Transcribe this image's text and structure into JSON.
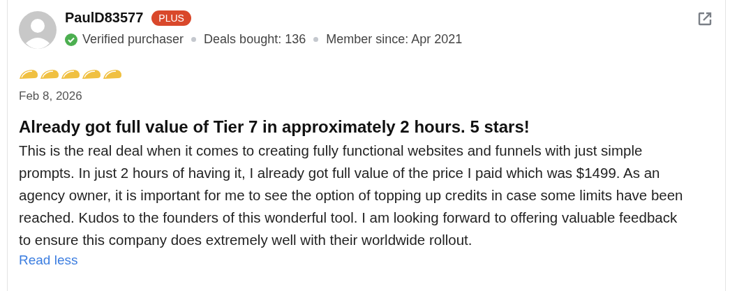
{
  "review": {
    "username": "PaulD83577",
    "badge": "PLUS",
    "verified": "Verified purchaser",
    "deals": "Deals bought: 136",
    "member_since": "Member since: Apr 2021",
    "stars": 5,
    "date": "Feb 8, 2026",
    "title": "Already got full value of Tier 7 in approximately 2 hours. 5 stars!",
    "body": "This is the real deal when it comes to creating fully functional websites and funnels with just simple prompts. In just 2 hours of having it, I already got full value of the price I paid which was $1499. As an agency owner, it is important for me to see the option of topping up credits in case some limits have been reached. Kudos to the founders of this wonderful tool. I am looking forward to offering valuable feedback to ensure this company does extremely well with their worldwide rollout.",
    "toggle": "Read less"
  }
}
